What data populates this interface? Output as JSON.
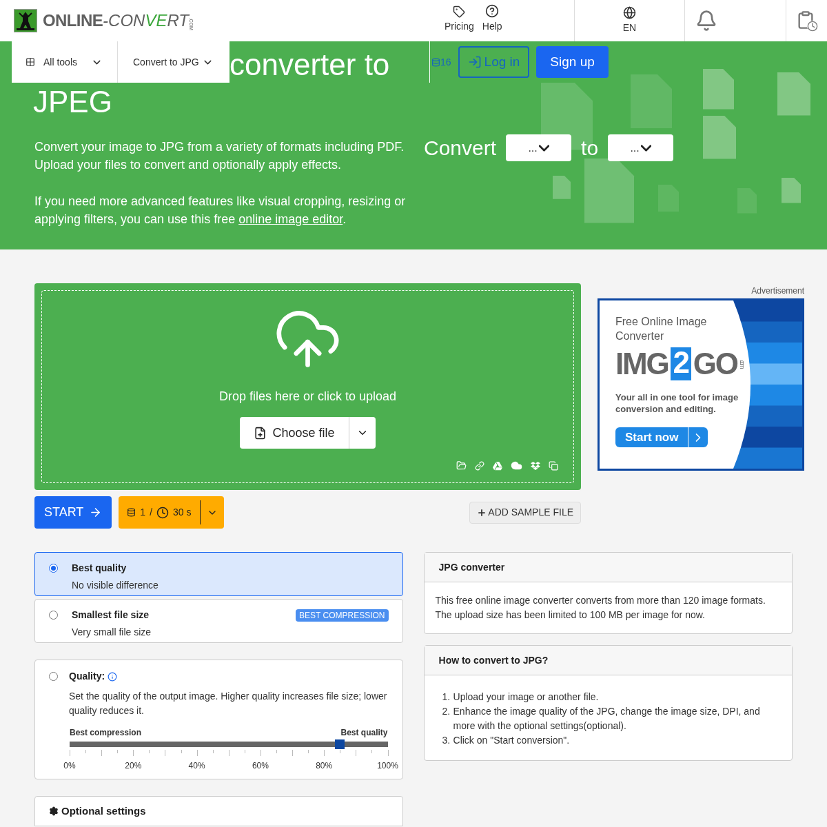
{
  "header": {
    "logo": {
      "main": "ONLINE",
      "rest": "-CON",
      "accent": "VE",
      "tail": "RT",
      "suffix": ".COM"
    },
    "links": [
      {
        "label": "Pricing",
        "kind": "tag"
      },
      {
        "label": "Help",
        "kind": "help"
      }
    ],
    "language": "EN"
  },
  "hero": {
    "nav": [
      {
        "label": "All tools",
        "kind": "grid"
      },
      {
        "label": "Convert to JPG",
        "kind": "plain"
      }
    ],
    "title_lines": [
      "converter to",
      "JPEG"
    ],
    "intro": "Convert your image to JPG from a variety of formats including PDF. Upload your files to convert and optionally apply effects.",
    "advanced": {
      "before": "If you need more advanced features like visual cropping, resizing or applying filters, you can use this free ",
      "link": "online image editor",
      "after": "."
    },
    "credits": "16",
    "login": "Log in",
    "signup": "Sign up",
    "convert": {
      "label": "Convert",
      "from": "...",
      "joiner": "to",
      "to": "..."
    }
  },
  "upload": {
    "hint": "Drop files here or click to upload",
    "button": "Choose file"
  },
  "actions": {
    "start": "START",
    "credits": "1",
    "separator": "/",
    "time": "30 s",
    "sample": "ADD SAMPLE FILE"
  },
  "ad": {
    "label": "Advertisement",
    "headline": "Free Online Image Converter",
    "brand_left": "IMG",
    "brand_mid": "2",
    "brand_right": "GO",
    "brand_suffix": ".com",
    "tagline": "Your all in one tool for image conversion and editing.",
    "cta": "Start now"
  },
  "presets": [
    {
      "title": "Best quality",
      "subtitle": "No visible difference",
      "selected": true
    },
    {
      "title": "Smallest file size",
      "subtitle": "Very small file size",
      "selected": false,
      "badge": "BEST COMPRESSION"
    }
  ],
  "quality": {
    "label": "Quality:",
    "selected": false,
    "description": "Set the quality of the output image. Higher quality increases file size; lower quality reduces it.",
    "left_label": "Best compression",
    "right_label": "Best quality",
    "level": 0.85,
    "ticks": [
      "0%",
      "20%",
      "40%",
      "60%",
      "80%",
      "100%"
    ]
  },
  "optional_settings": "Optional settings",
  "info": [
    {
      "title": "JPG converter",
      "kind": "paragraph",
      "text": "This free online image converter converts from more than 120 image formats. The upload size has been limited to 100 MB per image for now."
    },
    {
      "title": "How to convert to JPG?",
      "kind": "steps",
      "steps": [
        {
          "number": "1.",
          "text": "Upload your image or another file."
        },
        {
          "number": "2.",
          "text": "Enhance the image quality of the JPG, change the image size, DPI, and more with the optional settings(optional)."
        },
        {
          "number": "3.",
          "text": "Click on \"Start conversion\"."
        }
      ]
    }
  ]
}
